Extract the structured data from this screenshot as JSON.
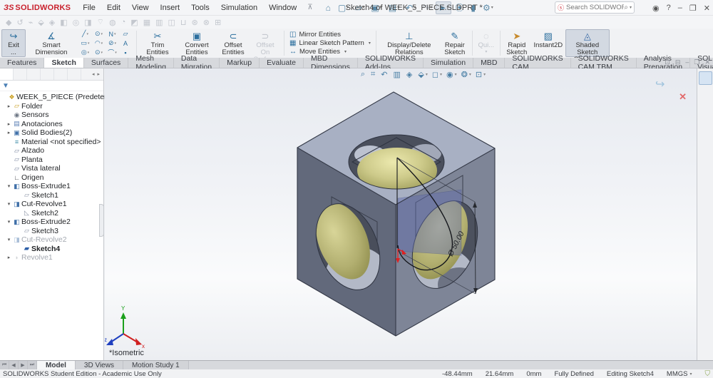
{
  "titlebar": {
    "logo_ds": "ЗS",
    "logo_text": "SOLIDWORKS",
    "menus": [
      {
        "label": "File"
      },
      {
        "label": "Edit"
      },
      {
        "label": "View"
      },
      {
        "label": "Insert"
      },
      {
        "label": "Tools"
      },
      {
        "label": "Simulation"
      },
      {
        "label": "Window"
      }
    ],
    "pin_glyph": "📌",
    "quick_icons": [
      {
        "name": "home-icon",
        "glyph": "⌂",
        "drop": ""
      },
      {
        "name": "new-document-icon",
        "glyph": "▢",
        "drop": "▾"
      },
      {
        "name": "open-icon",
        "glyph": "▱",
        "drop": "▾"
      },
      {
        "name": "save-icon",
        "glyph": "▣",
        "drop": "▾"
      },
      {
        "name": "print-icon",
        "glyph": "▤",
        "drop": "▾"
      },
      {
        "name": "undo-icon",
        "glyph": "↶",
        "drop": "▾"
      },
      {
        "name": "redo-icon",
        "glyph": "↷",
        "drop": "▾",
        "disabled": true
      },
      {
        "name": "select-cursor-icon",
        "glyph": "➤",
        "drop": "▾",
        "pressed": true
      },
      {
        "name": "traffic-light-icon",
        "glyph": "⦿",
        "drop": ""
      },
      {
        "name": "reorder-icon",
        "glyph": "▮",
        "drop": ""
      },
      {
        "name": "options-gear-icon",
        "glyph": "⚙",
        "drop": "▾"
      }
    ],
    "doc_title": "Sketch4 of WEEK_5_PIECE.SLDPRT *",
    "search_badge": "ⓢ",
    "search_placeholder": "Search SOLIDWORKS Help",
    "window_icons": [
      {
        "name": "user-account-icon",
        "glyph": "◉"
      },
      {
        "name": "help-icon",
        "glyph": "?"
      },
      {
        "name": "minimize-icon",
        "glyph": "–"
      },
      {
        "name": "restore-icon",
        "glyph": "❐"
      },
      {
        "name": "close-icon",
        "glyph": "✕"
      }
    ]
  },
  "features_toolbar": {
    "icons": [
      {
        "name": "extrude-boss-icon",
        "glyph": "◆"
      },
      {
        "name": "revolve-boss-icon",
        "glyph": "↺"
      },
      {
        "name": "swept-boss-icon",
        "glyph": "⌁"
      },
      {
        "name": "lofted-boss-icon",
        "glyph": "⬙"
      },
      {
        "name": "boundary-boss-icon",
        "glyph": "◈"
      },
      {
        "name": "extruded-cut-icon",
        "glyph": "◧"
      },
      {
        "name": "hole-wizard-icon",
        "glyph": "◎"
      },
      {
        "name": "revolved-cut-icon",
        "glyph": "◨"
      },
      {
        "name": "swept-cut-icon",
        "glyph": "⌔"
      },
      {
        "name": "lofted-cut-icon",
        "glyph": "◍"
      },
      {
        "name": "fillet-icon",
        "glyph": "◔"
      },
      {
        "name": "chamfer-icon",
        "glyph": "◩"
      },
      {
        "name": "linear-pattern-icon",
        "glyph": "▦"
      },
      {
        "name": "rib-icon",
        "glyph": "▥"
      },
      {
        "name": "draft-icon",
        "glyph": "◫"
      },
      {
        "name": "shell-icon",
        "glyph": "⊔"
      },
      {
        "name": "wrap-icon",
        "glyph": "⊛"
      },
      {
        "name": "intersect-icon",
        "glyph": "⊗"
      },
      {
        "name": "mirror-feature-icon",
        "glyph": "⊞"
      }
    ]
  },
  "ribbon": {
    "exit_label": "Exit ...",
    "smart_dimension": "Smart Dimension",
    "trim": "Trim Entities",
    "convert": "Convert Entities",
    "offset": "Offset Entities",
    "offset_surface": "Offset On Surface",
    "mirror": "Mirror Entities",
    "linear_pattern": "Linear Sketch Pattern",
    "move": "Move Entities",
    "display_delete": "Display/Delete Relations",
    "repair": "Repair Sketch",
    "quick_snaps": "Qui...",
    "rapid": "Rapid Sketch",
    "instant2d": "Instant2D",
    "shaded": "Shaded Sketch Contours",
    "icons": {
      "exit": "↪",
      "smart_dimension": "∡",
      "trim": "✂",
      "convert": "▣",
      "offset": "⊂",
      "offset_surface": "⊃",
      "display_delete": "⊥",
      "repair": "✎",
      "quick_snaps": "◌",
      "rapid": "➤",
      "instant2d": "▨",
      "shaded": "◬"
    },
    "sketch_grid": [
      {
        "name": "line-tool-icon",
        "glyph": "╱",
        "drop": "▾"
      },
      {
        "name": "circle-tool-icon",
        "glyph": "⊙",
        "drop": "▾"
      },
      {
        "name": "spline-tool-icon",
        "glyph": "Ν",
        "drop": "▾"
      },
      {
        "name": "sketch-plane-tool-icon",
        "glyph": "▱",
        "drop": ""
      },
      {
        "name": "rectangle-tool-icon",
        "glyph": "▭",
        "drop": "▾"
      },
      {
        "name": "arc-tool-icon",
        "glyph": "◠",
        "drop": "▾"
      },
      {
        "name": "ellipse-tool-icon",
        "glyph": "⊘",
        "drop": "▾"
      },
      {
        "name": "text-tool-icon",
        "glyph": "A",
        "drop": ""
      },
      {
        "name": "slot-tool-icon",
        "glyph": "◎",
        "drop": "▾"
      },
      {
        "name": "polygon-tool-icon",
        "glyph": "⊙",
        "drop": "▾"
      },
      {
        "name": "fillet-tool-icon",
        "glyph": "⌒",
        "drop": "▾"
      },
      {
        "name": "point-tool-icon",
        "glyph": "▪",
        "drop": ""
      }
    ]
  },
  "cmd_tabs": {
    "items": [
      {
        "label": "Features"
      },
      {
        "label": "Sketch",
        "active": true
      },
      {
        "label": "Surfaces"
      },
      {
        "label": "Mesh Modeling"
      },
      {
        "label": "Data Migration"
      },
      {
        "label": "Markup"
      },
      {
        "label": "Evaluate"
      },
      {
        "label": "MBD Dimensions"
      },
      {
        "label": "SOLIDWORKS Add-Ins"
      },
      {
        "label": "Simulation"
      },
      {
        "label": "MBD"
      },
      {
        "label": "SOLIDWORKS CAM"
      },
      {
        "label": "SOLIDWORKS CAM TBM"
      },
      {
        "label": "Analysis Preparation"
      },
      {
        "label": "SOLIDWORKS Visualize"
      }
    ],
    "window_icons": [
      {
        "name": "dock-icon",
        "glyph": "⊡"
      },
      {
        "name": "undock-icon",
        "glyph": "⊟"
      },
      {
        "name": "minimize-doc-icon",
        "glyph": "–"
      },
      {
        "name": "restore-doc-icon",
        "glyph": "❐"
      },
      {
        "name": "close-doc-icon",
        "glyph": "✕"
      }
    ]
  },
  "panel_tabs": {
    "icons": [
      {
        "name": "featuremanager-tree-tab-icon",
        "glyph": "❖",
        "icon_color": "#c79a16",
        "active": true
      },
      {
        "name": "propertymanager-tab-icon",
        "glyph": "▤",
        "icon_color": "#4a7fb5"
      },
      {
        "name": "configurationmanager-tab-icon",
        "glyph": "⚙",
        "icon_color": "#777c84"
      },
      {
        "name": "dimxpertmanager-tab-icon",
        "glyph": "⊕",
        "icon_color": "#555a62"
      },
      {
        "name": "displaymanager-tab-icon",
        "glyph": "❂",
        "icon_color": "#c05050"
      },
      {
        "name": "cam-tab-icon",
        "glyph": "◍",
        "icon_color": "#3a6fb0"
      }
    ],
    "filter_glyph": "▼"
  },
  "tree": {
    "items": [
      {
        "label": "WEEK_5_PIECE (Predeterminado)",
        "level": 0,
        "arrow": "",
        "icon_glyph": "❖",
        "icon_color": "#c79a16",
        "name": "tree-item-part"
      },
      {
        "label": "Folder",
        "level": 1,
        "arrow": "▸",
        "icon_glyph": "▱",
        "icon_color": "#c79a16",
        "name": "tree-item-folder"
      },
      {
        "label": "Sensors",
        "level": 1,
        "arrow": "",
        "icon_glyph": "◉",
        "icon_color": "#6d7684",
        "name": "tree-item-sensors"
      },
      {
        "label": "Anotaciones",
        "level": 1,
        "arrow": "▸",
        "icon_glyph": "▤",
        "icon_color": "#5b7fb4",
        "name": "tree-item-annotations"
      },
      {
        "label": "Solid Bodies(2)",
        "level": 1,
        "arrow": "▸",
        "icon_glyph": "▣",
        "icon_color": "#3f6fa8",
        "name": "tree-item-solid-bodies"
      },
      {
        "label": "Material <not specified>",
        "level": 1,
        "arrow": "",
        "icon_glyph": "≡",
        "icon_color": "#3f8ca8",
        "name": "tree-item-material"
      },
      {
        "label": "Alzado",
        "level": 1,
        "arrow": "",
        "icon_glyph": "▱",
        "icon_color": "#7b87a0",
        "name": "tree-item-plane-front"
      },
      {
        "label": "Planta",
        "level": 1,
        "arrow": "",
        "icon_glyph": "▱",
        "icon_color": "#7b87a0",
        "name": "tree-item-plane-top"
      },
      {
        "label": "Vista lateral",
        "level": 1,
        "arrow": "",
        "icon_glyph": "▱",
        "icon_color": "#7b87a0",
        "name": "tree-item-plane-side"
      },
      {
        "label": "Origen",
        "level": 1,
        "arrow": "",
        "icon_glyph": "∟",
        "icon_color": "#44474d",
        "name": "tree-item-origin"
      },
      {
        "label": "Boss-Extrude1",
        "level": 1,
        "arrow": "▾",
        "icon_glyph": "◧",
        "icon_color": "#3f6fa8",
        "name": "tree-item-boss-extrude1"
      },
      {
        "label": "Sketch1",
        "level": 2,
        "arrow": "",
        "icon_glyph": "▱",
        "icon_color": "#8a93a5",
        "name": "tree-item-sketch1"
      },
      {
        "label": "Cut-Revolve1",
        "level": 1,
        "arrow": "▾",
        "icon_glyph": "◨",
        "icon_color": "#3f6fa8",
        "name": "tree-item-cut-revolve1"
      },
      {
        "label": "Sketch2",
        "level": 2,
        "arrow": "",
        "icon_glyph": "◺",
        "icon_color": "#8a93a5",
        "name": "tree-item-sketch2"
      },
      {
        "label": "Boss-Extrude2",
        "level": 1,
        "arrow": "▾",
        "icon_glyph": "◧",
        "icon_color": "#3f6fa8",
        "name": "tree-item-boss-extrude2"
      },
      {
        "label": "Sketch3",
        "level": 2,
        "arrow": "",
        "icon_glyph": "▱",
        "icon_color": "#8a93a5",
        "name": "tree-item-sketch3"
      },
      {
        "label": "Cut-Revolve2",
        "level": 1,
        "arrow": "▾",
        "icon_glyph": "◨",
        "icon_color": "#3f6fa8",
        "style": "disabled",
        "name": "tree-item-cut-revolve2"
      },
      {
        "label": "Sketch4",
        "level": 2,
        "arrow": "",
        "icon_glyph": "▰",
        "icon_color": "#2d5fa8",
        "style": "bold",
        "name": "tree-item-sketch4"
      },
      {
        "label": "Revolve1",
        "level": 1,
        "arrow": "▸",
        "icon_glyph": "◗",
        "icon_color": "#9aa0a8",
        "style": "disabled",
        "name": "tree-item-revolve1"
      }
    ]
  },
  "headsup": {
    "icons": [
      {
        "name": "zoom-to-fit-icon",
        "glyph": "⌕",
        "drop": ""
      },
      {
        "name": "zoom-to-area-icon",
        "glyph": "⌗",
        "drop": ""
      },
      {
        "name": "previous-view-icon",
        "glyph": "↶",
        "drop": ""
      },
      {
        "name": "section-view-icon",
        "glyph": "▥",
        "drop": ""
      },
      {
        "name": "dynamic-annotation-icon",
        "glyph": "◈",
        "drop": ""
      },
      {
        "name": "view-orientation-icon",
        "glyph": "⬙",
        "drop": "▾"
      },
      {
        "name": "display-style-icon",
        "glyph": "◻",
        "drop": "▾"
      },
      {
        "name": "hide-show-items-icon",
        "glyph": "◉",
        "drop": "▾"
      },
      {
        "name": "edit-appearance-icon",
        "glyph": "❂",
        "drop": "▾"
      },
      {
        "name": "view-settings-icon",
        "glyph": "⊡",
        "drop": "▾"
      }
    ]
  },
  "viewport": {
    "view_label": "*Isometric",
    "dimension_label": "Ø 50.00",
    "confirm_exit_glyph": "↪",
    "confirm_cancel_glyph": "✕",
    "triad_labels": {
      "x": "x",
      "y": "Y",
      "z": "z"
    }
  },
  "task_pane": {
    "icons": [
      {
        "name": "threedexperience-icon",
        "glyph": "◍",
        "icon_color": "#2d6fc2",
        "active": true
      },
      {
        "name": "resources-home-icon",
        "glyph": "⌂",
        "icon_color": "#b8862c"
      },
      {
        "name": "design-library-icon",
        "glyph": "▥",
        "icon_color": "#777c84"
      },
      {
        "name": "file-explorer-icon",
        "glyph": "▱",
        "icon_color": "#c7a24a"
      },
      {
        "name": "view-palette-icon",
        "glyph": "▨",
        "icon_color": "#6f8f56"
      },
      {
        "name": "appearances-scenes-icon",
        "glyph": "❂",
        "icon_color": "#c05050"
      },
      {
        "name": "custom-properties-icon",
        "glyph": "▤",
        "icon_color": "#3a6fb0"
      }
    ]
  },
  "bottom_tabs": {
    "nav_icons": [
      {
        "name": "tab-scroll-first-icon",
        "glyph": "⏮"
      },
      {
        "name": "tab-scroll-prev-icon",
        "glyph": "◀"
      },
      {
        "name": "tab-scroll-next-icon",
        "glyph": "▶"
      },
      {
        "name": "tab-scroll-last-icon",
        "glyph": "⏭"
      }
    ],
    "items": [
      {
        "label": "Model",
        "active": true
      },
      {
        "label": "3D Views"
      },
      {
        "label": "Motion Study 1"
      }
    ]
  },
  "status": {
    "left": "SOLIDWORKS Student Edition - Academic Use Only",
    "coord_x": "-48.44mm",
    "coord_y": "21.64mm",
    "coord_z": "0mm",
    "define_state": "Fully Defined",
    "editing": "Editing Sketch4",
    "units": "MMGS",
    "colors": {
      "accent_red": "#c9202c",
      "sphere": "#b9b679",
      "cube_top": "#a8b0c3",
      "cube_left": "#62697b",
      "cube_right": "#7e8597"
    }
  }
}
